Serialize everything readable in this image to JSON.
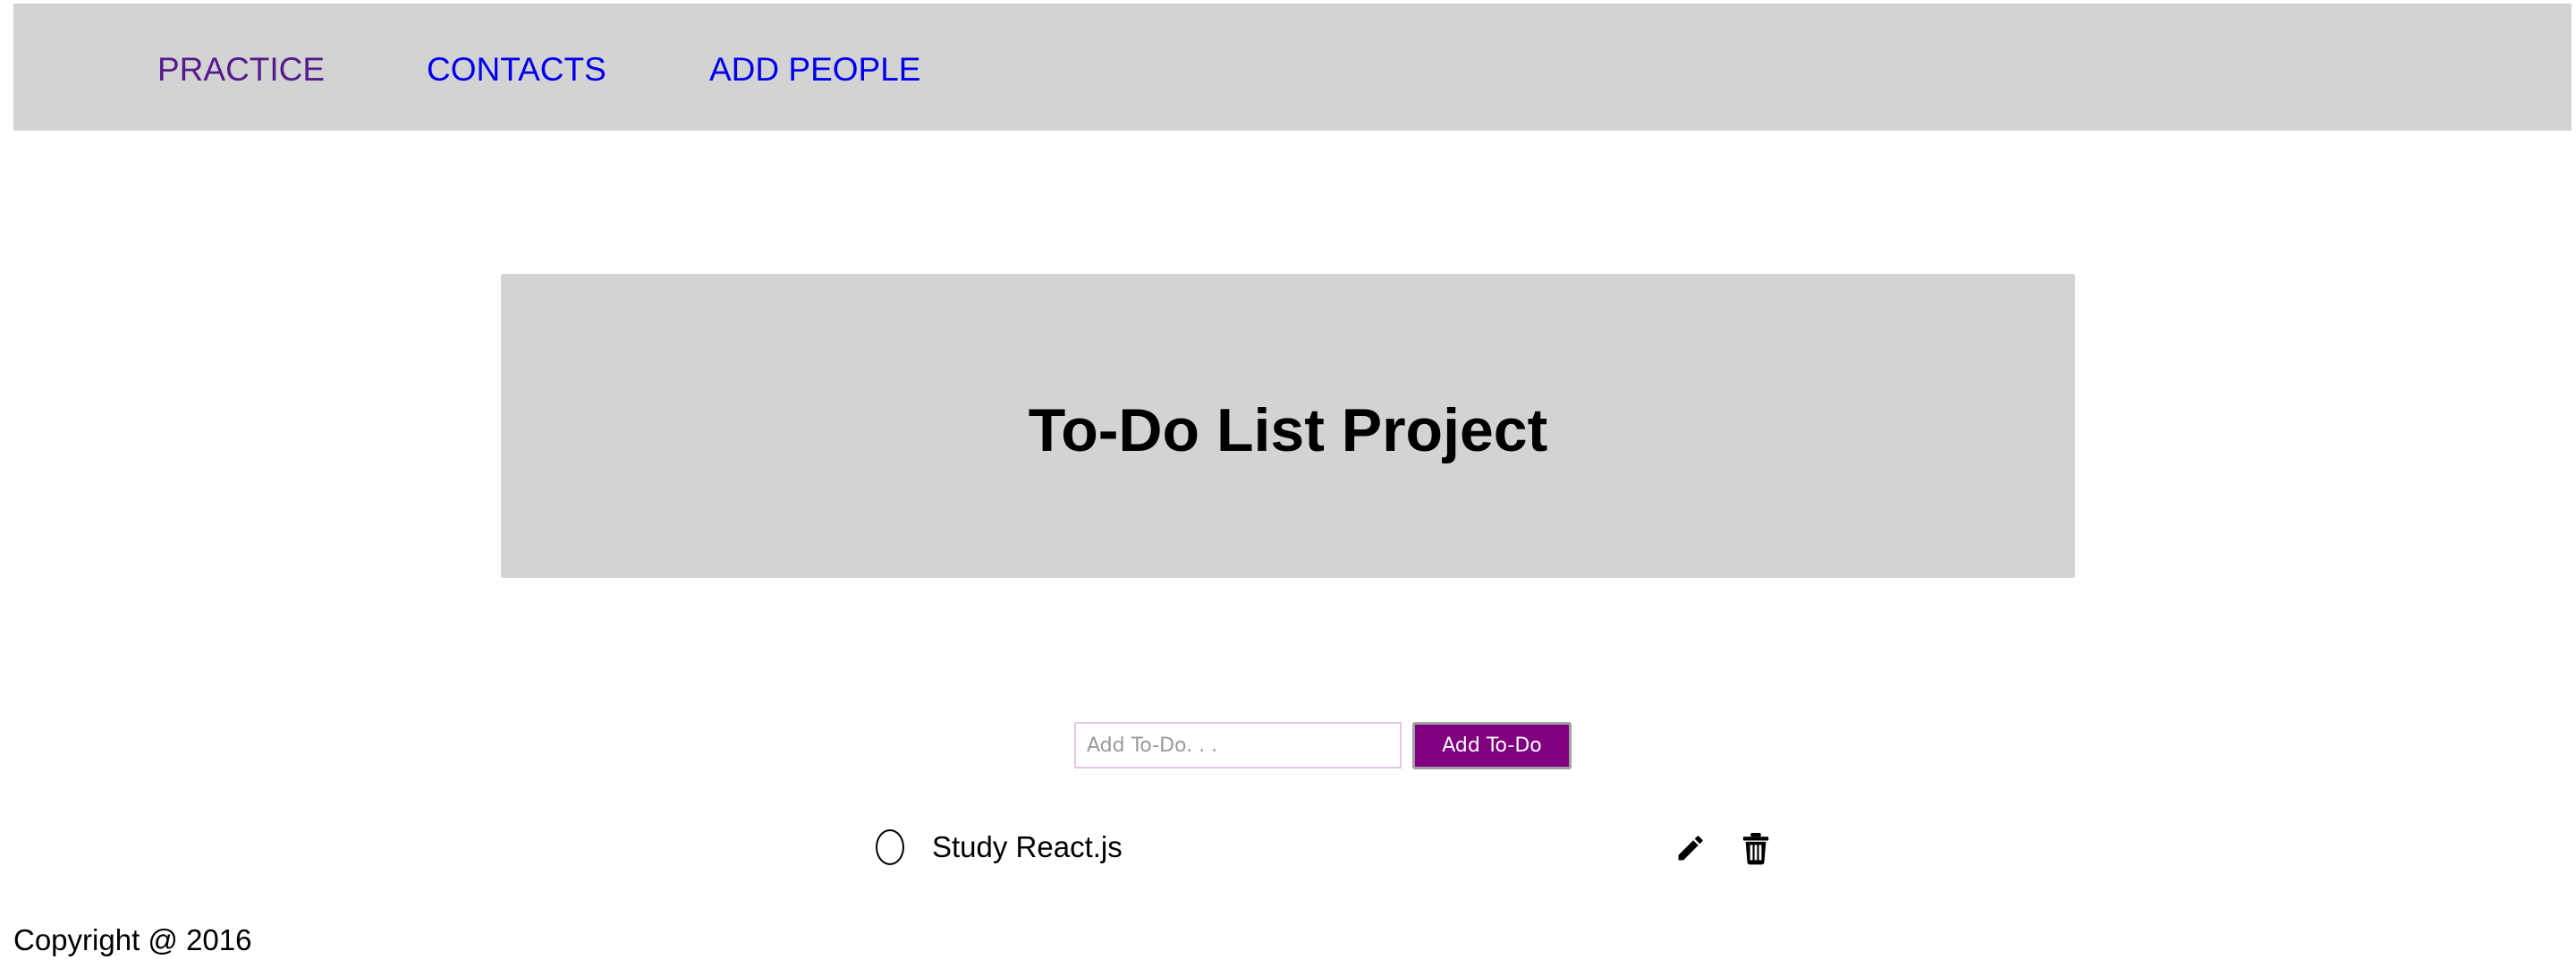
{
  "nav": {
    "items": [
      {
        "label": "PRACTICE",
        "visited": true
      },
      {
        "label": "CONTACTS",
        "visited": false
      },
      {
        "label": "ADD PEOPLE",
        "visited": false
      }
    ]
  },
  "hero": {
    "title": "To-Do List Project"
  },
  "form": {
    "input_value": "",
    "input_placeholder": "Add To-Do. . .",
    "submit_label": "Add To-Do"
  },
  "todos": [
    {
      "text": "Study React.js",
      "completed": false,
      "actions": [
        "pencil-icon",
        "trash-icon"
      ]
    }
  ],
  "footer": {
    "text": "Copyright @ 2016"
  },
  "colors": {
    "nav_background": "#d3d3d3",
    "hero_background": "#d3d3d3",
    "visited_link": "#551a8b",
    "link": "#0000ee",
    "button_background": "#800080",
    "button_text": "#ffffff"
  }
}
